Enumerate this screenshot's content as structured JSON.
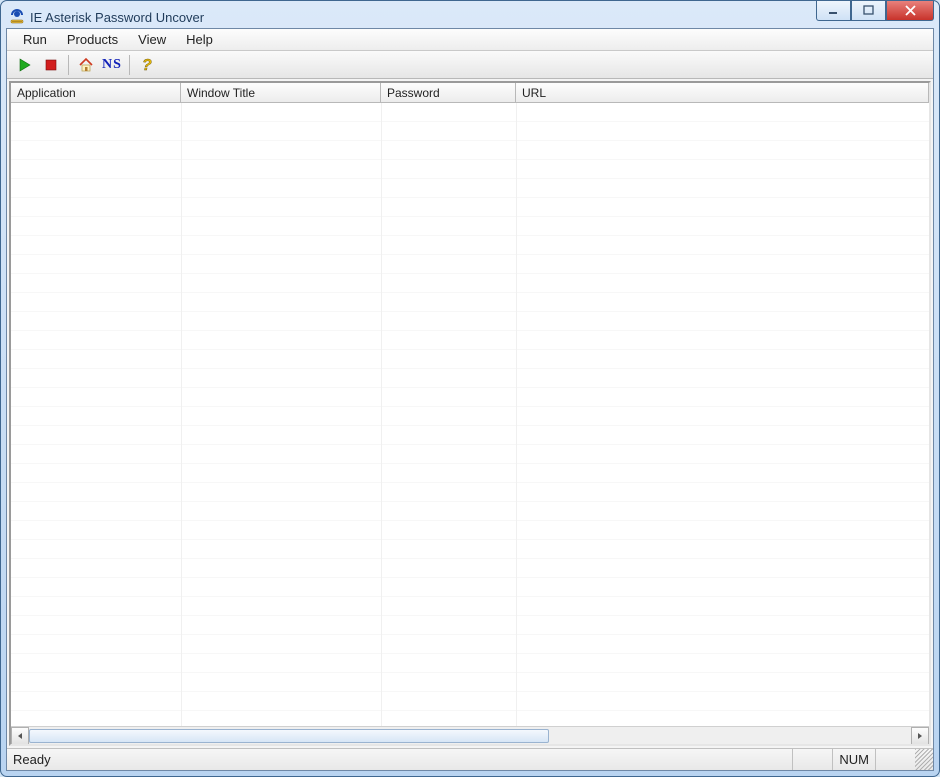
{
  "window": {
    "title": "IE Asterisk Password Uncover"
  },
  "menu": {
    "run": "Run",
    "products": "Products",
    "view": "View",
    "help": "Help"
  },
  "toolbar": {
    "ns_label": "NS"
  },
  "columns": {
    "application": "Application",
    "window_title": "Window Title",
    "password": "Password",
    "url": "URL"
  },
  "column_widths": {
    "application": 170,
    "window_title": 200,
    "password": 135,
    "url": 405
  },
  "status": {
    "ready": "Ready",
    "num": "NUM"
  },
  "scroll": {
    "thumb_width": 520
  }
}
